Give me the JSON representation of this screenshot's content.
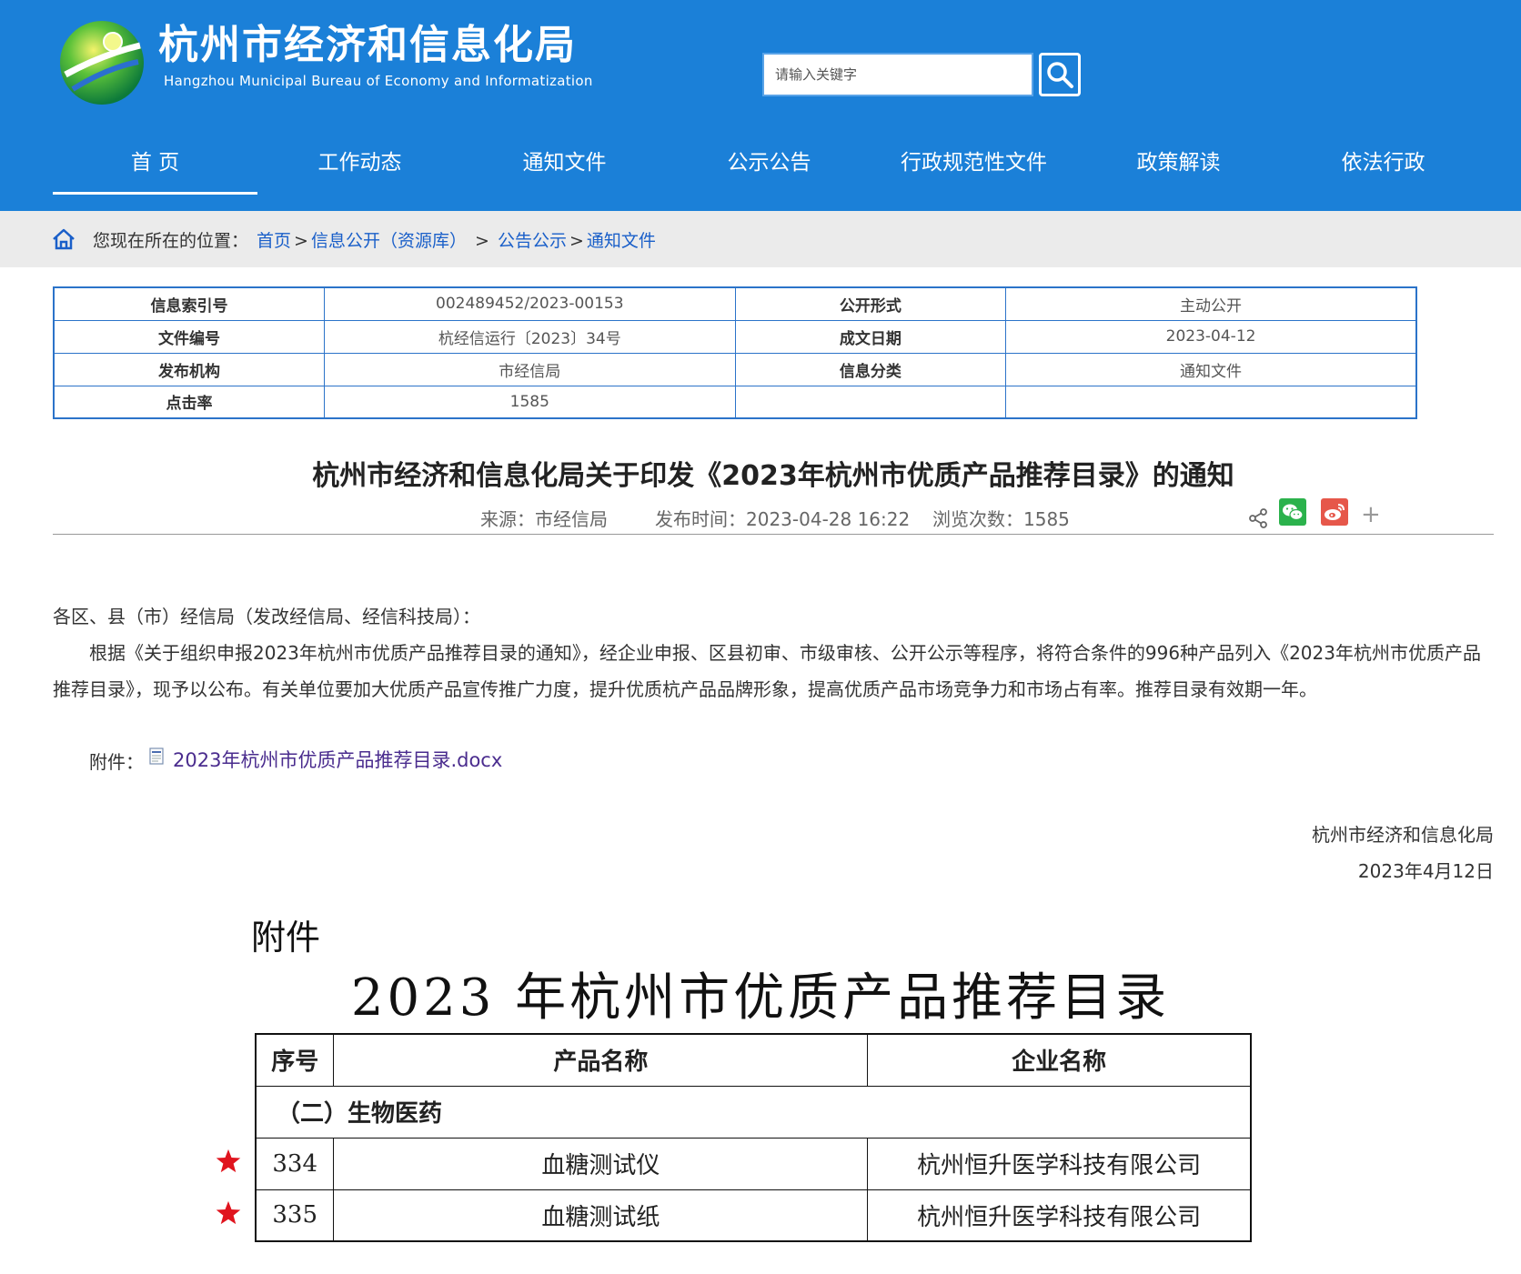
{
  "header": {
    "title": "杭州市经济和信息化局",
    "subtitle": "Hangzhou Municipal Bureau of Economy and Informatization",
    "search_placeholder": "请输入关键字"
  },
  "nav": [
    "首 页",
    "工作动态",
    "通知文件",
    "公示公告",
    "行政规范性文件",
    "政策解读",
    "依法行政"
  ],
  "breadcrumb": {
    "prefix": "您现在所在的位置：",
    "links": [
      "首页",
      "信息公开（资源库）",
      "公告公示",
      "通知文件"
    ],
    "separators": [
      ">",
      " > ",
      ">"
    ]
  },
  "info": {
    "rows": [
      [
        "信息索引号",
        "002489452/2023-00153",
        "公开形式",
        "主动公开"
      ],
      [
        "文件编号",
        "杭经信运行〔2023〕34号",
        "成文日期",
        "2023-04-12"
      ],
      [
        "发布机构",
        "市经信局",
        "信息分类",
        "通知文件"
      ],
      [
        "点击率",
        "1585",
        "",
        ""
      ]
    ]
  },
  "article": {
    "title": "杭州市经济和信息化局关于印发《2023年杭州市优质产品推荐目录》的通知",
    "source": "来源：市经信局",
    "publish_time": "发布时间：2023-04-28 16:22",
    "views": "浏览次数：1585",
    "greeting": "各区、县（市）经信局（发改经信局、经信科技局）：",
    "paragraph": "根据《关于组织申报2023年杭州市优质产品推荐目录的通知》，经企业申报、区县初审、市级审核、公开公示等程序，将符合条件的996种产品列入《2023年杭州市优质产品推荐目录》，现予以公布。有关单位要加大优质产品宣传推广力度，提升优质杭产品品牌形象，提高优质产品市场竞争力和市场占有率。推荐目录有效期一年。",
    "attachment_label": "附件：",
    "attachment_name": "2023年杭州市优质产品推荐目录.docx",
    "signature_org": "杭州市经济和信息化局",
    "signature_date": "2023年4月12日"
  },
  "annex": {
    "label": "附件",
    "title": "2023 年杭州市优质产品推荐目录",
    "headers": [
      "序号",
      "产品名称",
      "企业名称"
    ],
    "category": "（二）生物医药",
    "rows": [
      {
        "no": "334",
        "product": "血糖测试仪",
        "company": "杭州恒升医学科技有限公司"
      },
      {
        "no": "335",
        "product": "血糖测试纸",
        "company": "杭州恒升医学科技有限公司"
      }
    ]
  },
  "icons": [
    "home-icon",
    "search-icon",
    "share-icon",
    "wechat-icon",
    "weibo-icon",
    "plus-icon",
    "document-icon",
    "star-icon"
  ],
  "colors": {
    "header_bg": "#1b80d8",
    "link": "#1a5fc9",
    "table_border": "#2b73c9",
    "star": "#e0141e"
  }
}
